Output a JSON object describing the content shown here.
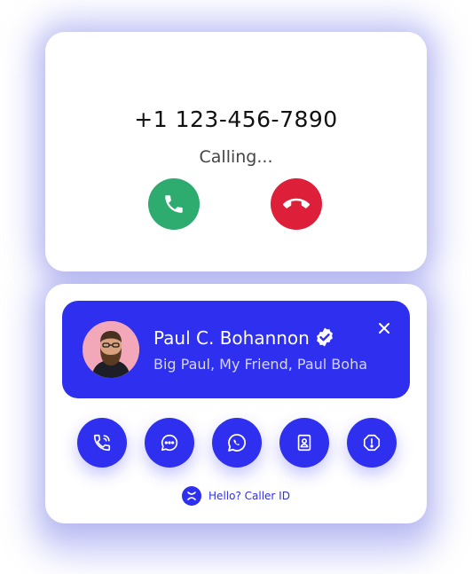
{
  "call": {
    "phone_number": "+1 123-456-7890",
    "status": "Calling..."
  },
  "caller_id": {
    "name": "Paul C. Bohannon",
    "aliases": "Big Paul, My Friend, Paul Boha",
    "verified": true
  },
  "actions": [
    {
      "icon": "phone-call-icon"
    },
    {
      "icon": "message-icon"
    },
    {
      "icon": "whatsapp-icon"
    },
    {
      "icon": "contact-card-icon"
    },
    {
      "icon": "alert-icon"
    }
  ],
  "brand": {
    "name": "Hello? Caller ID"
  },
  "colors": {
    "accent": "#2f2ff0",
    "answer": "#2eab6e",
    "decline": "#dd1f3a",
    "glow": "#b9bbf5"
  }
}
